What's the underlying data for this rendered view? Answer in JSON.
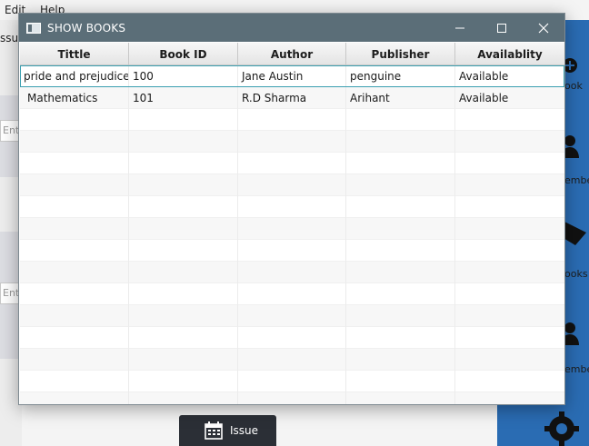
{
  "background_app": {
    "menu": [
      "Edit",
      "Help"
    ],
    "issue_tab_fragment": "ssue",
    "input_placeholder_fragment": "Ente",
    "right_labels": [
      "ook",
      "embe",
      "ooks",
      "embe"
    ],
    "issue_button_label": "Issue",
    "accent_color": "#2a6cb3"
  },
  "window": {
    "title": "SHOW BOOKS",
    "controls": [
      "minimize-icon",
      "maximize-icon",
      "close-icon"
    ]
  },
  "table": {
    "columns": [
      "Tittle",
      "Book ID",
      "Author",
      "Publisher",
      "Availablity"
    ],
    "rows": [
      [
        "pride and prejudice",
        "100",
        "Jane Austin",
        "penguine",
        "Available"
      ],
      [
        "Mathematics",
        "101",
        "R.D Sharma",
        "Arihant",
        "Available"
      ]
    ],
    "selected_row_index": 0
  }
}
